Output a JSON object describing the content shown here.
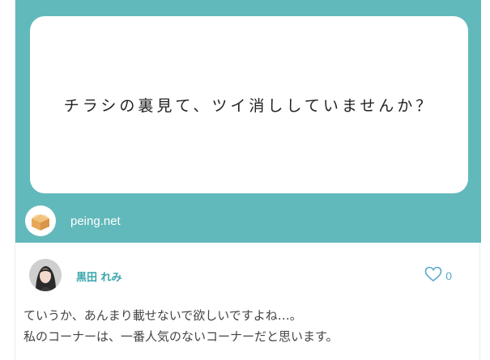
{
  "question": {
    "text": "チラシの裏見て、ツイ消ししていませんか？"
  },
  "source": {
    "logo_icon": "box-icon",
    "label": "peing.net"
  },
  "author": {
    "name": "黒田 れみ",
    "avatar_icon": "avatar-icon"
  },
  "like": {
    "icon": "heart-icon",
    "count": "0"
  },
  "answer": {
    "lines": [
      "ていうか、あんまり載せないで欲しいですよね…。",
      "私のコーナーは、一番人気のないコーナーだと思います。"
    ]
  },
  "colors": {
    "panel_teal": "#62b9bb",
    "name_teal": "#3aa6ad",
    "like_blue": "#5aa9c9",
    "answer_text": "#444444"
  }
}
